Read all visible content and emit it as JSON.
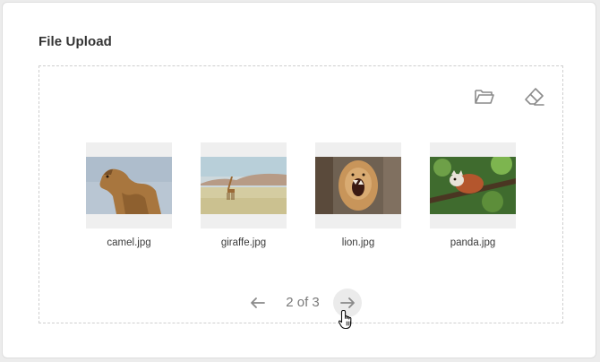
{
  "panel": {
    "title": "File Upload"
  },
  "toolbar": {
    "choose_icon": "folder-open-icon",
    "clear_icon": "eraser-icon"
  },
  "files": [
    {
      "name": "camel.jpg"
    },
    {
      "name": "giraffe.jpg"
    },
    {
      "name": "lion.jpg"
    },
    {
      "name": "panda.jpg"
    }
  ],
  "pagination": {
    "label": "2 of 3",
    "prev_icon": "arrow-left-icon",
    "next_icon": "arrow-right-icon"
  },
  "colors": {
    "icon": "#8a8a8a",
    "text": "#333333",
    "border": "#cfcfcf"
  }
}
